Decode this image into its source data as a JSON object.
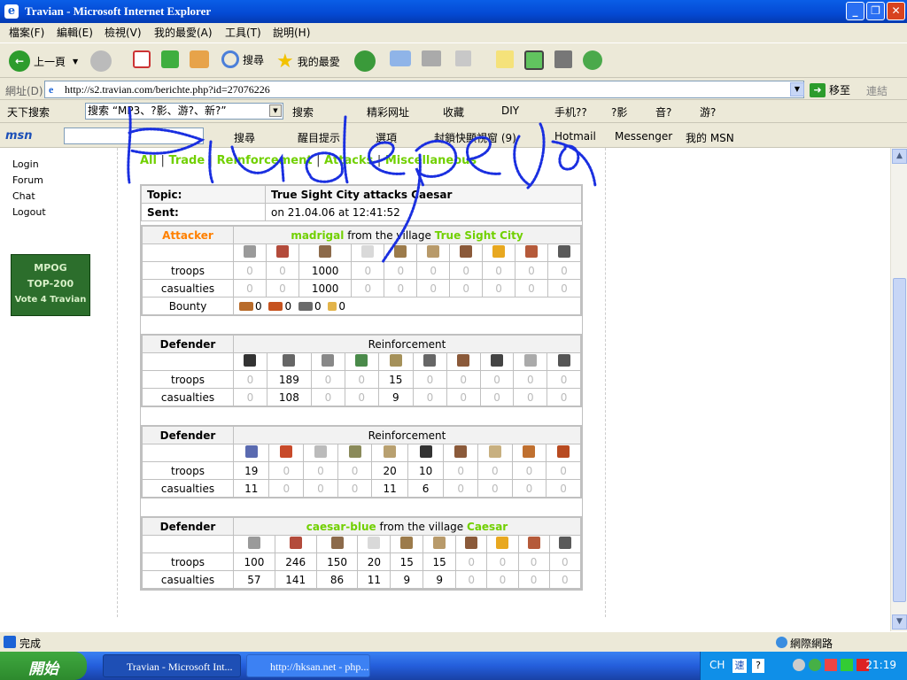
{
  "window": {
    "title": "Travian - Microsoft Internet Explorer"
  },
  "menubar": {
    "items": [
      "檔案(F)",
      "編輯(E)",
      "檢視(V)",
      "我的最愛(A)",
      "工具(T)",
      "說明(H)"
    ]
  },
  "toolbar": {
    "back": "上一頁",
    "search": "搜尋",
    "favorites": "我的最愛"
  },
  "address": {
    "label": "網址(D)",
    "url": "http://s2.travian.com/berichte.php?id=27076226",
    "go": "移至",
    "links": "連結"
  },
  "linkbar": {
    "toolbar_name": "天下搜索",
    "search_value": "搜索 “MP3、?影、游?、新?”",
    "search": "搜索",
    "items": [
      "精彩网址",
      "收藏",
      "DIY",
      "手机??",
      "?影",
      "音?",
      "游?"
    ]
  },
  "msnbar": {
    "logo": "msn",
    "search": "搜尋",
    "highlight": "醒目提示",
    "options": "選項",
    "popup": "封鎖快顯視窗 (9)",
    "hotmail": "Hotmail",
    "messenger": "Messenger",
    "mymsn": "我的 MSN"
  },
  "leftnav": {
    "items": [
      "Login",
      "Forum",
      "Chat",
      "Logout"
    ],
    "badge_lines": [
      "MPOG",
      "TOP-200",
      "Vote 4 Travian"
    ]
  },
  "filters": [
    "All",
    "Trade",
    "Reinforcement",
    "Attacks",
    "Miscellaneous"
  ],
  "report": {
    "topic_label": "Topic:",
    "topic": "True Sight City attacks Caesar",
    "sent_label": "Sent:",
    "sent": "on 21.04.06 at 12:41:52"
  },
  "row_labels": {
    "troops": "troops",
    "casualties": "casualties",
    "bounty": "Bounty"
  },
  "attacker": {
    "role": "Attacker",
    "player": "madrigal",
    "from": "from the village",
    "village": "True Sight City",
    "troops": [
      "0",
      "0",
      "1000",
      "0",
      "0",
      "0",
      "0",
      "0",
      "0",
      "0"
    ],
    "casualties": [
      "0",
      "0",
      "1000",
      "0",
      "0",
      "0",
      "0",
      "0",
      "0",
      "0"
    ],
    "bounty": [
      "0",
      "0",
      "0",
      "0"
    ]
  },
  "defender1": {
    "role": "Defender",
    "label": "Reinforcement",
    "troops": [
      "0",
      "189",
      "0",
      "0",
      "15",
      "0",
      "0",
      "0",
      "0",
      "0"
    ],
    "casualties": [
      "0",
      "108",
      "0",
      "0",
      "9",
      "0",
      "0",
      "0",
      "0",
      "0"
    ]
  },
  "defender2": {
    "role": "Defender",
    "label": "Reinforcement",
    "troops": [
      "19",
      "0",
      "0",
      "0",
      "20",
      "10",
      "0",
      "0",
      "0",
      "0"
    ],
    "casualties": [
      "11",
      "0",
      "0",
      "0",
      "11",
      "6",
      "0",
      "0",
      "0",
      "0"
    ]
  },
  "defender3": {
    "role": "Defender",
    "player": "caesar-blue",
    "from": "from the village",
    "village": "Caesar",
    "troops": [
      "100",
      "246",
      "150",
      "20",
      "15",
      "15",
      "0",
      "0",
      "0",
      "0"
    ],
    "casualties": [
      "57",
      "141",
      "86",
      "11",
      "9",
      "9",
      "0",
      "0",
      "0",
      "0"
    ]
  },
  "statusbar": {
    "text": "完成",
    "zone": "網際網路"
  },
  "taskbar": {
    "start": "開始",
    "tasks": [
      "Travian - Microsoft Int...",
      "http://hksan.net - php..."
    ],
    "lang": "CH",
    "clock": "21:19"
  },
  "colors": {
    "accent_green": "#71d000",
    "attacker_orange": "#ff8000",
    "scribble_blue": "#1a2fe0"
  }
}
